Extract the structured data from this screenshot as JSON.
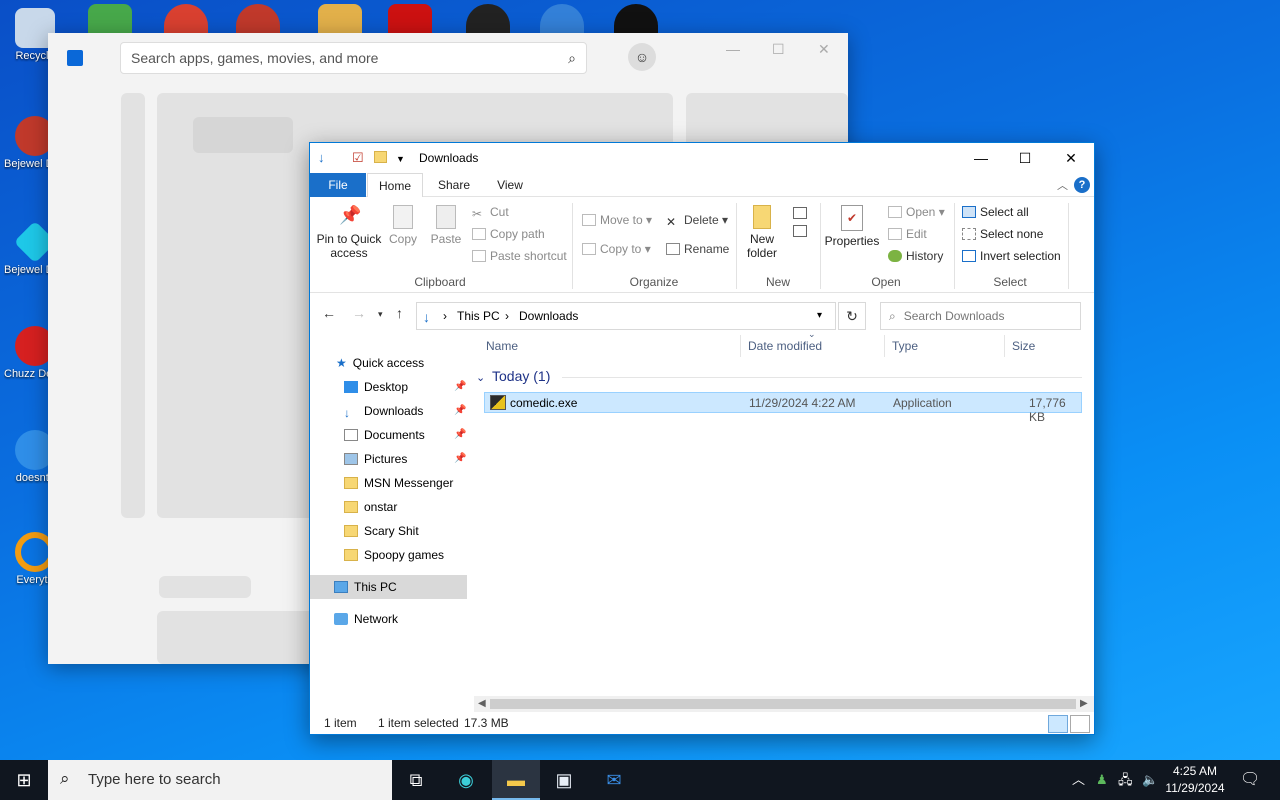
{
  "desktop": {
    "icons": [
      {
        "label": "Recycle",
        "color": "#c8d8ea"
      },
      {
        "label": "Bejewel Delux",
        "color": "#c0392b"
      },
      {
        "label": "Bejewel Delux",
        "color": "#1ec8e8"
      },
      {
        "label": "Chuzz Delux",
        "color": "#d62020"
      },
      {
        "label": "doesnt l",
        "color": "#2f8ee8"
      },
      {
        "label": "Everyth",
        "color": "#f39c12"
      }
    ]
  },
  "store": {
    "search_placeholder": "Search apps, games, movies, and more",
    "minimize": "—",
    "maximize": "☐",
    "close": "✕"
  },
  "explorer": {
    "title": "Downloads",
    "tabs": {
      "file": "File",
      "home": "Home",
      "share": "Share",
      "view": "View"
    },
    "ribbon": {
      "clipboard": {
        "label": "Clipboard",
        "pin": "Pin to Quick access",
        "copy": "Copy",
        "paste": "Paste",
        "cut": "Cut",
        "copy_path": "Copy path",
        "paste_shortcut": "Paste shortcut"
      },
      "organize": {
        "label": "Organize",
        "move_to": "Move to",
        "copy_to": "Copy to",
        "delete": "Delete",
        "rename": "Rename"
      },
      "new": {
        "label": "New",
        "new_folder": "New folder"
      },
      "open": {
        "label": "Open",
        "properties": "Properties",
        "open": "Open",
        "edit": "Edit",
        "history": "History"
      },
      "select": {
        "label": "Select",
        "select_all": "Select all",
        "select_none": "Select none",
        "invert": "Invert selection"
      }
    },
    "address": {
      "crumbs": [
        "This PC",
        "Downloads"
      ],
      "search_placeholder": "Search Downloads"
    },
    "nav_pane": [
      {
        "label": "Quick access",
        "pinned": false
      },
      {
        "label": "Desktop",
        "pinned": true
      },
      {
        "label": "Downloads",
        "pinned": true
      },
      {
        "label": "Documents",
        "pinned": true
      },
      {
        "label": "Pictures",
        "pinned": true
      },
      {
        "label": "MSN Messenger",
        "pinned": false
      },
      {
        "label": "onstar",
        "pinned": false
      },
      {
        "label": "Scary Shit",
        "pinned": false
      },
      {
        "label": "Spoopy games",
        "pinned": false
      },
      {
        "label": "This PC",
        "pinned": false
      },
      {
        "label": "Network",
        "pinned": false
      }
    ],
    "columns": {
      "name": "Name",
      "date": "Date modified",
      "type": "Type",
      "size": "Size"
    },
    "group": "Today (1)",
    "files": [
      {
        "name": "comedic.exe",
        "date": "11/29/2024 4:22 AM",
        "type": "Application",
        "size": "17,776 KB"
      }
    ],
    "status": {
      "count": "1 item",
      "selected": "1 item selected",
      "size": "17.3 MB"
    }
  },
  "taskbar": {
    "search_placeholder": "Type here to search",
    "time": "4:25 AM",
    "date": "11/29/2024"
  }
}
